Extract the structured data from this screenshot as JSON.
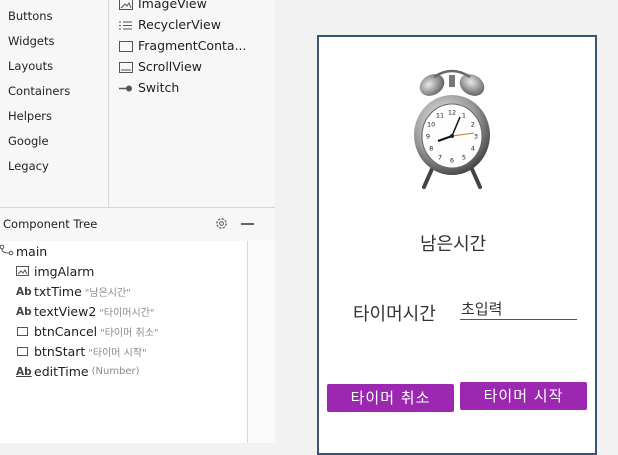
{
  "palette": {
    "categories": [
      "Buttons",
      "Widgets",
      "Layouts",
      "Containers",
      "Helpers",
      "Google",
      "Legacy"
    ],
    "items": [
      {
        "label": "ImageView",
        "icon": "image-icon"
      },
      {
        "label": "RecyclerView",
        "icon": "list-icon"
      },
      {
        "label": "FragmentConta...",
        "icon": "box-icon"
      },
      {
        "label": "ScrollView",
        "icon": "scroll-icon"
      },
      {
        "label": "Switch",
        "icon": "switch-icon"
      }
    ]
  },
  "component_tree": {
    "title": "Component Tree",
    "root": "main",
    "nodes": [
      {
        "type": "image",
        "name": "imgAlarm",
        "hint": ""
      },
      {
        "type": "Ab",
        "name": "txtTime",
        "hint": "\"남은시간\""
      },
      {
        "type": "Ab",
        "name": "textView2",
        "hint": "\"타이머시간\""
      },
      {
        "type": "button",
        "name": "btnCancel",
        "hint": "\"타이머 취소\""
      },
      {
        "type": "button",
        "name": "btnStart",
        "hint": "\"타이머 시작\""
      },
      {
        "type": "Ab",
        "name": "editTime",
        "hint": "(Number)"
      }
    ]
  },
  "design": {
    "remaining_label": "남은시간",
    "timer_label": "타이머시간",
    "input_placeholder": "초입력",
    "cancel_button": "타이머 취소",
    "start_button": "타이머 시작",
    "clock_numbers": [
      "12",
      "1",
      "2",
      "3",
      "4",
      "5",
      "6",
      "7",
      "8",
      "9",
      "10",
      "11"
    ],
    "accent_color": "#9c27b0"
  }
}
